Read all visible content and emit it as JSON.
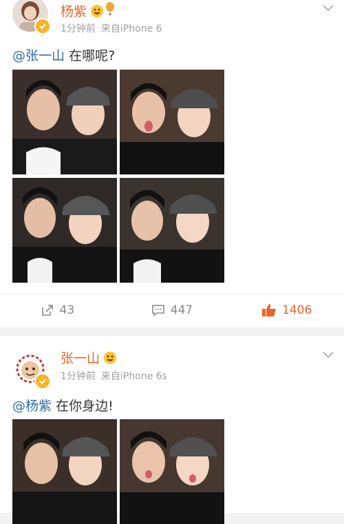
{
  "posts": [
    {
      "username": "杨紫",
      "time": "1分钟前",
      "source": "来自iPhone 6",
      "mention": "@张一山",
      "text": "在哪呢?",
      "photo_count": 4,
      "reposts": "43",
      "comments": "447",
      "likes": "1406"
    },
    {
      "username": "张一山",
      "time": "1分钟前",
      "source": "来自iPhone 6s",
      "mention": "@杨紫",
      "text": "在你身边!",
      "photo_count": 2
    }
  ],
  "colors": {
    "username": "#e8662c",
    "mention": "#2d6ea8",
    "meta": "#a0a0a0",
    "liked": "#e8662c",
    "verified_badge": "#f7b52c"
  },
  "icons": [
    "verified-icon",
    "emoji-icon",
    "balloon-icon",
    "chevron-down-icon",
    "repost-icon",
    "comment-icon",
    "like-icon"
  ]
}
